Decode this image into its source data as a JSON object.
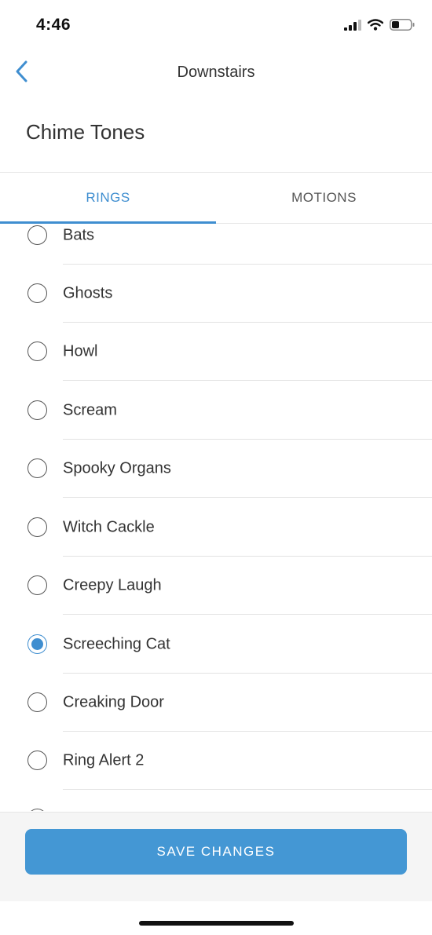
{
  "status_bar": {
    "time": "4:46",
    "icons": [
      "signal-icon",
      "wifi-icon",
      "battery-icon"
    ]
  },
  "nav": {
    "back_icon": "chevron-left-icon",
    "title": "Downstairs"
  },
  "page": {
    "title": "Chime Tones"
  },
  "tabs": [
    {
      "label": "RINGS",
      "active": true
    },
    {
      "label": "MOTIONS",
      "active": false
    }
  ],
  "tones": [
    {
      "label": "Bats",
      "selected": false
    },
    {
      "label": "Ghosts",
      "selected": false
    },
    {
      "label": "Howl",
      "selected": false
    },
    {
      "label": "Scream",
      "selected": false
    },
    {
      "label": "Spooky Organs",
      "selected": false
    },
    {
      "label": "Witch Cackle",
      "selected": false
    },
    {
      "label": "Creepy Laugh",
      "selected": false
    },
    {
      "label": "Screeching Cat",
      "selected": true
    },
    {
      "label": "Creaking Door",
      "selected": false
    },
    {
      "label": "Ring Alert 2",
      "selected": false
    },
    {
      "label": "",
      "selected": false
    }
  ],
  "footer": {
    "save_label": "SAVE CHANGES"
  },
  "colors": {
    "accent": "#3f8ed0",
    "button": "#4497d4"
  }
}
